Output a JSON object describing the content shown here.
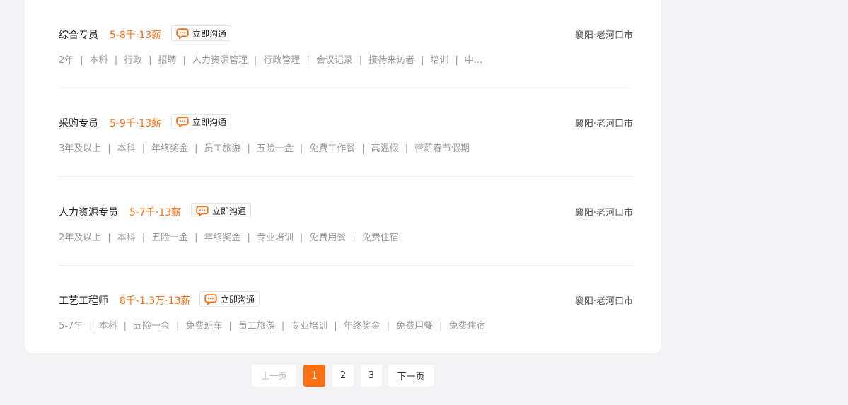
{
  "jobs": [
    {
      "title": "综合专员",
      "salary": "5-8千·13薪",
      "chat_label": "立即沟通",
      "location": "襄阳·老河口市",
      "tags": [
        "2年",
        "本科",
        "行政",
        "招聘",
        "人力资源管理",
        "行政管理",
        "会议记录",
        "接待来访者",
        "培训",
        "中..."
      ]
    },
    {
      "title": "采购专员",
      "salary": "5-9千·13薪",
      "chat_label": "立即沟通",
      "location": "襄阳·老河口市",
      "tags": [
        "3年及以上",
        "本科",
        "年终奖金",
        "员工旅游",
        "五险一金",
        "免费工作餐",
        "高温假",
        "带薪春节假期"
      ]
    },
    {
      "title": "人力资源专员",
      "salary": "5-7千·13薪",
      "chat_label": "立即沟通",
      "location": "襄阳·老河口市",
      "tags": [
        "2年及以上",
        "本科",
        "五险一金",
        "年终奖金",
        "专业培训",
        "免费用餐",
        "免费住宿"
      ]
    },
    {
      "title": "工艺工程师",
      "salary": "8千-1.3万·13薪",
      "chat_label": "立即沟通",
      "location": "襄阳·老河口市",
      "tags": [
        "5-7年",
        "本科",
        "五险一金",
        "免费班车",
        "员工旅游",
        "专业培训",
        "年终奖金",
        "免费用餐",
        "免费住宿"
      ]
    }
  ],
  "pagination": {
    "prev_label": "上一页",
    "pages": [
      "1",
      "2",
      "3"
    ],
    "current_page": "1",
    "next_label": "下一页"
  },
  "colors": {
    "accent": "#fe7013",
    "background": "#f3f3f5",
    "tag_text": "#999999"
  },
  "icons": {
    "chat": "chat-bubble-icon"
  }
}
